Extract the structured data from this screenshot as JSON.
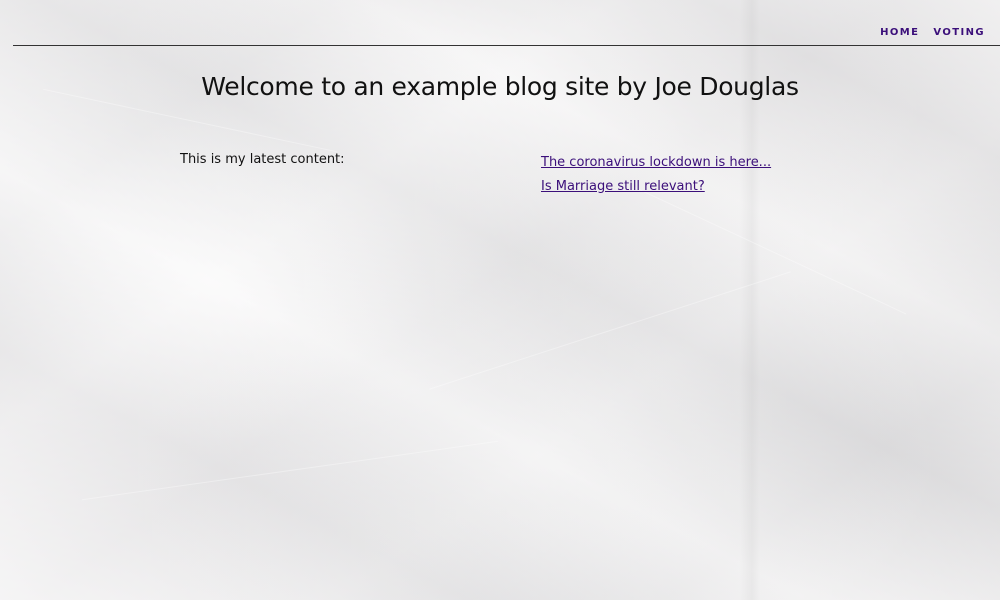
{
  "nav": {
    "items": [
      {
        "label": "HOME"
      },
      {
        "label": "VOTING"
      }
    ]
  },
  "main": {
    "title": "Welcome to an example blog site by Joe Douglas",
    "intro": "This is my latest content:",
    "posts": [
      {
        "title": "The coronavirus lockdown is here..."
      },
      {
        "title": "Is Marriage still relevant?"
      }
    ]
  },
  "colors": {
    "link": "#3b0f7a",
    "text": "#111111",
    "background": "#ebe9ea",
    "nav_rule": "#333333"
  }
}
